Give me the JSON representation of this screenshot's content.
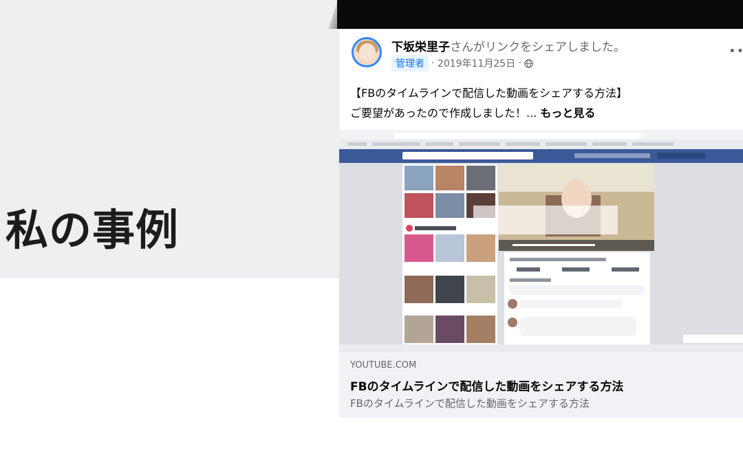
{
  "slide": {
    "title": "私の事例"
  },
  "post": {
    "author": "下坂栄里子",
    "action": "さんがリンクをシェアしました。",
    "badge": "管理者",
    "date": "2019年11月25日",
    "more_icon": "more-horizontal-icon",
    "privacy_icon": "globe-icon",
    "text_line1": "【FBのタイムラインで配信した動画をシェアする方法】",
    "text_line2": "ご要望があったので作成しました！... ",
    "see_more": "もっと見る"
  },
  "preview": {
    "url": "facebook.com/..."
  },
  "link": {
    "domain": "YOUTUBE.COM",
    "title": "FBのタイムラインで配信した動画をシェアする方法",
    "description": "FBのタイムラインで配信した動画をシェアする方法"
  },
  "colors": {
    "accent": "#1877f2",
    "avatar_ring": "#2d88ff",
    "fb_bar": "#3b5998"
  }
}
